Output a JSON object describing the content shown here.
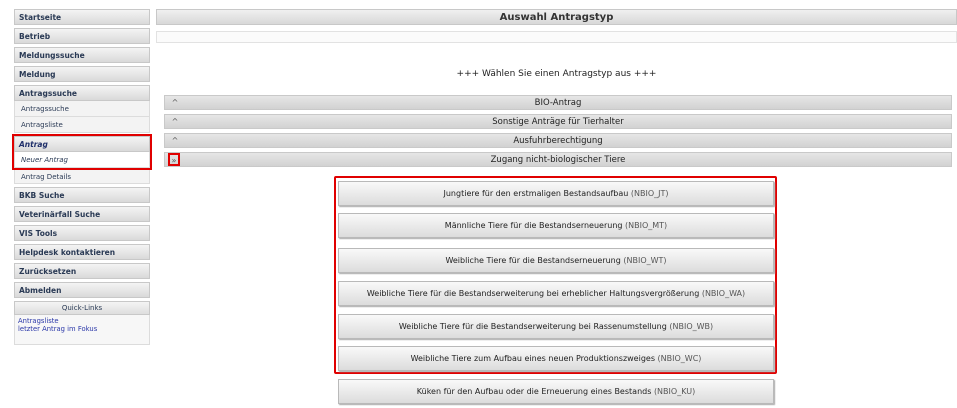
{
  "sidebar": {
    "items": [
      {
        "label": "Startseite"
      },
      {
        "label": "Betrieb"
      },
      {
        "label": "Meldungssuche"
      },
      {
        "label": "Meldung"
      }
    ],
    "antragssuche": {
      "label": "Antragssuche",
      "sub": [
        "Antragssuche",
        "Antragsliste"
      ]
    },
    "antrag": {
      "label": "Antrag",
      "sub_active": "Neuer Antrag",
      "sub_other": "Antrag Details"
    },
    "items_after": [
      {
        "label": "BKB Suche"
      },
      {
        "label": "Veterinärfall Suche"
      },
      {
        "label": "VIS Tools"
      },
      {
        "label": "Helpdesk kontaktieren"
      },
      {
        "label": "Zurücksetzen"
      },
      {
        "label": "Abmelden"
      }
    ],
    "quick_links": {
      "header": "Quick-Links",
      "links": [
        "Antragsliste",
        "letzter Antrag im Fokus"
      ]
    }
  },
  "main": {
    "header": "Auswahl Antragstyp",
    "prompt": "+++ Wählen Sie einen Antragstyp aus +++",
    "categories": [
      {
        "label": "BIO-Antrag",
        "icon": "chevron-up-icon",
        "chevron": "^"
      },
      {
        "label": "Sonstige Anträge für Tierhalter",
        "icon": "chevron-up-icon",
        "chevron": "^"
      },
      {
        "label": "Ausfuhrberechtigung",
        "icon": "chevron-up-icon",
        "chevron": "^"
      },
      {
        "label": "Zugang nicht-biologischer Tiere",
        "icon": "chevron-down-icon",
        "chevron": "»"
      }
    ],
    "options": [
      {
        "label": "Jungtiere für den erstmaligen Bestandsaufbau",
        "code": "(NBIO_JT)"
      },
      {
        "label": "Männliche Tiere für die Bestandserneuerung",
        "code": "(NBIO_MT)"
      },
      {
        "label": "Weibliche Tiere für die Bestandserneuerung",
        "code": "(NBIO_WT)"
      },
      {
        "label": "Weibliche Tiere für die Bestandserweiterung bei erheblicher Haltungsvergrößerung",
        "code": "(NBIO_WA)"
      },
      {
        "label": "Weibliche Tiere für die Bestandserweiterung bei Rassenumstellung",
        "code": "(NBIO_WB)"
      },
      {
        "label": "Weibliche Tiere zum Aufbau eines neuen Produktionszweiges",
        "code": "(NBIO_WC)"
      },
      {
        "label": "Küken für den Aufbau oder die Erneuerung eines Bestands",
        "code": "(NBIO_KU)"
      }
    ]
  },
  "colors": {
    "highlight": "#e00000",
    "nav_text": "#2a3a55",
    "link": "#2a37a8"
  }
}
